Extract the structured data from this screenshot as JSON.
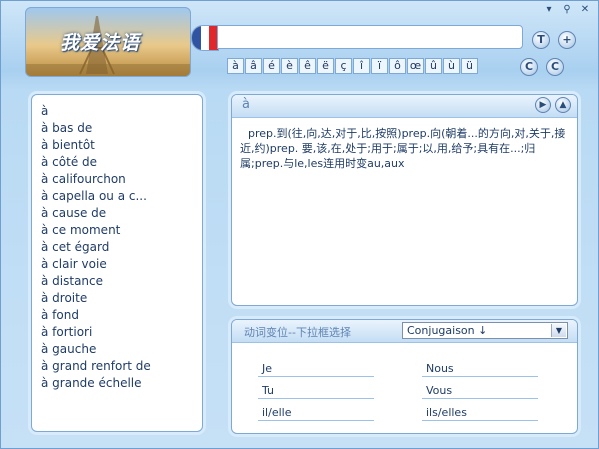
{
  "window": {
    "controls": [
      {
        "name": "dropdown-icon",
        "glyph": "▾"
      },
      {
        "name": "pin-icon",
        "glyph": "⚲"
      },
      {
        "name": "close-icon",
        "glyph": "✕"
      }
    ]
  },
  "logo": {
    "text": "我爱法语"
  },
  "flag_colors": [
    "#3154a0",
    "#ffffff",
    "#e0272b"
  ],
  "search": {
    "value": ""
  },
  "top_buttons": {
    "t": "T",
    "add": "+"
  },
  "accents": [
    "à",
    "â",
    "é",
    "è",
    "ê",
    "ë",
    "ç",
    "î",
    "ï",
    "ô",
    "œ",
    "û",
    "ù",
    "ü"
  ],
  "side_buttons": [
    {
      "name": "copy-icon",
      "glyph": "C"
    },
    {
      "name": "cut-icon",
      "glyph": "C"
    }
  ],
  "wordlist": [
    "à",
    "à bas de",
    "à bientôt",
    "à côté de",
    "à califourchon",
    "à capella ou a c...",
    "à cause de",
    "à ce moment",
    "à cet égard",
    "à clair voie",
    "à distance",
    "à droite",
    "à fond",
    "à fortiori",
    "à gauche",
    "à grand renfort de",
    "à grande échelle"
  ],
  "definition_panel": {
    "headword": "à",
    "text": "prep.到(往,向,达,对于,比,按照)prep.向(朝着...的方向,对,关于,接近,约)prep. 要,该,在,处于;用于;属于;以,用,给予;具有在...;归属;prep.与le,les连用时变au,aux"
  },
  "conjugation": {
    "title": "动词变位--下拉框选择",
    "selected": "Conjugaison ↓",
    "pronouns_left": [
      "Je",
      "Tu",
      "il/elle"
    ],
    "pronouns_right": [
      "Nous",
      "Vous",
      "ils/elles"
    ]
  }
}
